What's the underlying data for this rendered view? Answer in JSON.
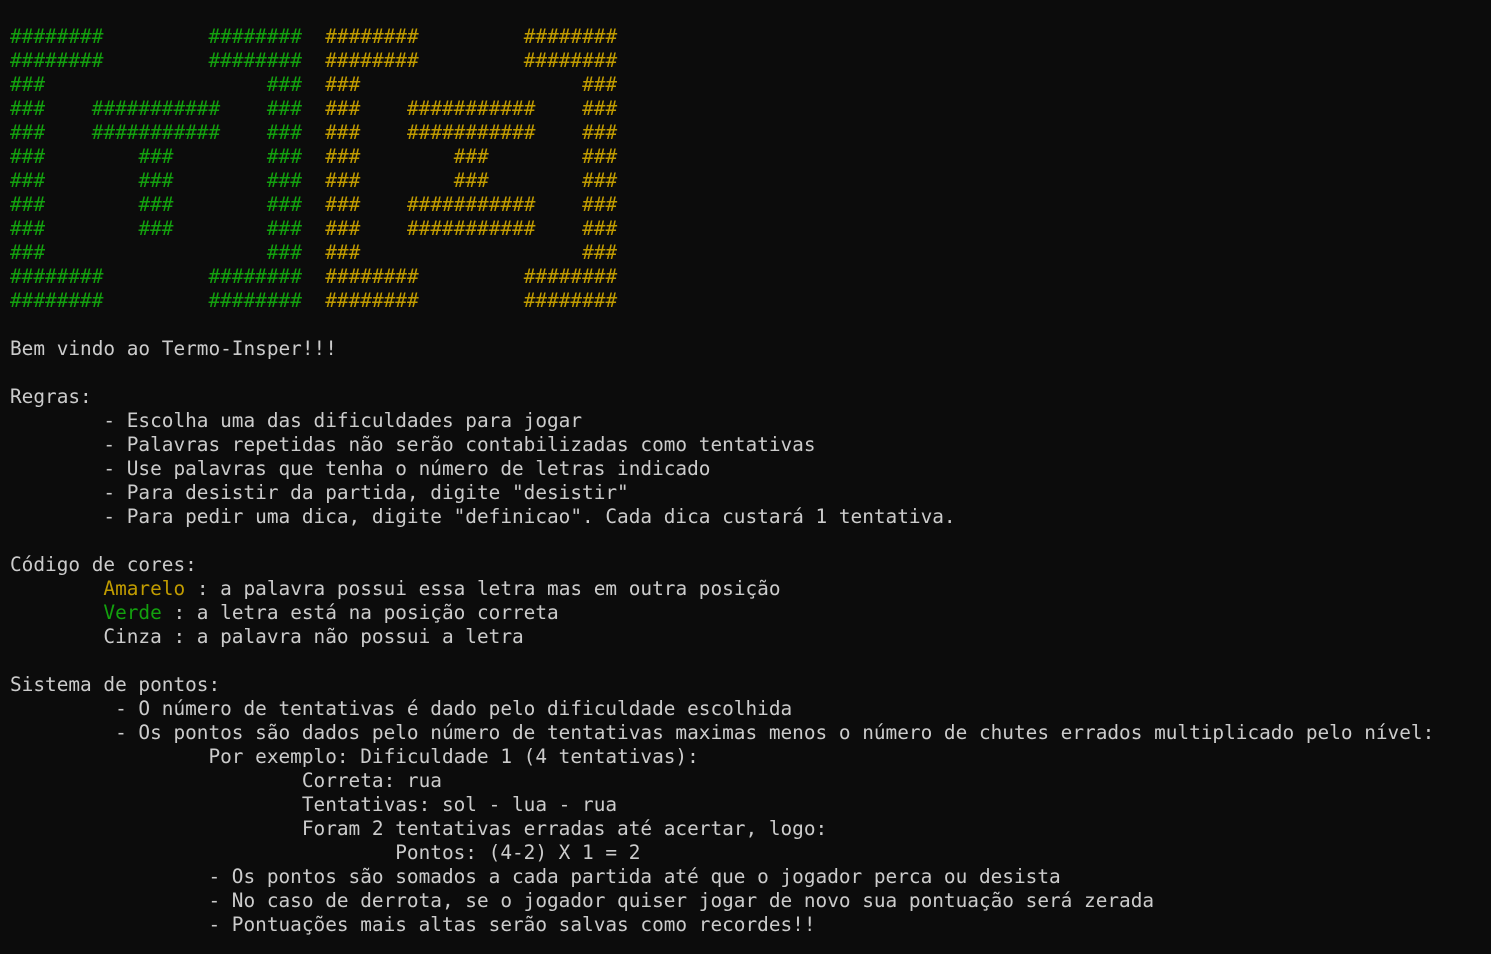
{
  "terminal": {
    "colors": {
      "background": "#0c0c0c",
      "text": "#cccccc",
      "green": "#13a10e",
      "yellow": "#c19c00"
    },
    "lines": [
      [
        {
          "t": "########",
          "c": "green"
        },
        {
          "t": "         ",
          "c": "plain"
        },
        {
          "t": "########",
          "c": "green"
        },
        {
          "t": "  ",
          "c": "plain"
        },
        {
          "t": "########",
          "c": "yellow"
        },
        {
          "t": "         ",
          "c": "plain"
        },
        {
          "t": "########",
          "c": "yellow"
        }
      ],
      [
        {
          "t": "########",
          "c": "green"
        },
        {
          "t": "         ",
          "c": "plain"
        },
        {
          "t": "########",
          "c": "green"
        },
        {
          "t": "  ",
          "c": "plain"
        },
        {
          "t": "########",
          "c": "yellow"
        },
        {
          "t": "         ",
          "c": "plain"
        },
        {
          "t": "########",
          "c": "yellow"
        }
      ],
      [
        {
          "t": "###",
          "c": "green"
        },
        {
          "t": "                   ",
          "c": "plain"
        },
        {
          "t": "###",
          "c": "green"
        },
        {
          "t": "  ",
          "c": "plain"
        },
        {
          "t": "###",
          "c": "yellow"
        },
        {
          "t": "                   ",
          "c": "plain"
        },
        {
          "t": "###",
          "c": "yellow"
        }
      ],
      [
        {
          "t": "###",
          "c": "green"
        },
        {
          "t": "    ",
          "c": "plain"
        },
        {
          "t": "###########",
          "c": "green"
        },
        {
          "t": "    ",
          "c": "plain"
        },
        {
          "t": "###",
          "c": "green"
        },
        {
          "t": "  ",
          "c": "plain"
        },
        {
          "t": "###",
          "c": "yellow"
        },
        {
          "t": "    ",
          "c": "plain"
        },
        {
          "t": "###########",
          "c": "yellow"
        },
        {
          "t": "    ",
          "c": "plain"
        },
        {
          "t": "###",
          "c": "yellow"
        }
      ],
      [
        {
          "t": "###",
          "c": "green"
        },
        {
          "t": "    ",
          "c": "plain"
        },
        {
          "t": "###########",
          "c": "green"
        },
        {
          "t": "    ",
          "c": "plain"
        },
        {
          "t": "###",
          "c": "green"
        },
        {
          "t": "  ",
          "c": "plain"
        },
        {
          "t": "###",
          "c": "yellow"
        },
        {
          "t": "    ",
          "c": "plain"
        },
        {
          "t": "###########",
          "c": "yellow"
        },
        {
          "t": "    ",
          "c": "plain"
        },
        {
          "t": "###",
          "c": "yellow"
        }
      ],
      [
        {
          "t": "###",
          "c": "green"
        },
        {
          "t": "        ",
          "c": "plain"
        },
        {
          "t": "###",
          "c": "green"
        },
        {
          "t": "        ",
          "c": "plain"
        },
        {
          "t": "###",
          "c": "green"
        },
        {
          "t": "  ",
          "c": "plain"
        },
        {
          "t": "###",
          "c": "yellow"
        },
        {
          "t": "        ",
          "c": "plain"
        },
        {
          "t": "###",
          "c": "yellow"
        },
        {
          "t": "        ",
          "c": "plain"
        },
        {
          "t": "###",
          "c": "yellow"
        }
      ],
      [
        {
          "t": "###",
          "c": "green"
        },
        {
          "t": "        ",
          "c": "plain"
        },
        {
          "t": "###",
          "c": "green"
        },
        {
          "t": "        ",
          "c": "plain"
        },
        {
          "t": "###",
          "c": "green"
        },
        {
          "t": "  ",
          "c": "plain"
        },
        {
          "t": "###",
          "c": "yellow"
        },
        {
          "t": "        ",
          "c": "plain"
        },
        {
          "t": "###",
          "c": "yellow"
        },
        {
          "t": "        ",
          "c": "plain"
        },
        {
          "t": "###",
          "c": "yellow"
        }
      ],
      [
        {
          "t": "###",
          "c": "green"
        },
        {
          "t": "        ",
          "c": "plain"
        },
        {
          "t": "###",
          "c": "green"
        },
        {
          "t": "        ",
          "c": "plain"
        },
        {
          "t": "###",
          "c": "green"
        },
        {
          "t": "  ",
          "c": "plain"
        },
        {
          "t": "###",
          "c": "yellow"
        },
        {
          "t": "    ",
          "c": "plain"
        },
        {
          "t": "###########",
          "c": "yellow"
        },
        {
          "t": "    ",
          "c": "plain"
        },
        {
          "t": "###",
          "c": "yellow"
        }
      ],
      [
        {
          "t": "###",
          "c": "green"
        },
        {
          "t": "        ",
          "c": "plain"
        },
        {
          "t": "###",
          "c": "green"
        },
        {
          "t": "        ",
          "c": "plain"
        },
        {
          "t": "###",
          "c": "green"
        },
        {
          "t": "  ",
          "c": "plain"
        },
        {
          "t": "###",
          "c": "yellow"
        },
        {
          "t": "    ",
          "c": "plain"
        },
        {
          "t": "###########",
          "c": "yellow"
        },
        {
          "t": "    ",
          "c": "plain"
        },
        {
          "t": "###",
          "c": "yellow"
        }
      ],
      [
        {
          "t": "###",
          "c": "green"
        },
        {
          "t": "                   ",
          "c": "plain"
        },
        {
          "t": "###",
          "c": "green"
        },
        {
          "t": "  ",
          "c": "plain"
        },
        {
          "t": "###",
          "c": "yellow"
        },
        {
          "t": "                   ",
          "c": "plain"
        },
        {
          "t": "###",
          "c": "yellow"
        }
      ],
      [
        {
          "t": "########",
          "c": "green"
        },
        {
          "t": "         ",
          "c": "plain"
        },
        {
          "t": "########",
          "c": "green"
        },
        {
          "t": "  ",
          "c": "plain"
        },
        {
          "t": "########",
          "c": "yellow"
        },
        {
          "t": "         ",
          "c": "plain"
        },
        {
          "t": "########",
          "c": "yellow"
        }
      ],
      [
        {
          "t": "########",
          "c": "green"
        },
        {
          "t": "         ",
          "c": "plain"
        },
        {
          "t": "########",
          "c": "green"
        },
        {
          "t": "  ",
          "c": "plain"
        },
        {
          "t": "########",
          "c": "yellow"
        },
        {
          "t": "         ",
          "c": "plain"
        },
        {
          "t": "########",
          "c": "yellow"
        }
      ],
      [],
      [
        {
          "t": "Bem vindo ao Termo-Insper!!!",
          "c": "plain"
        }
      ],
      [],
      [
        {
          "t": "Regras:",
          "c": "plain"
        }
      ],
      [
        {
          "t": "        - Escolha uma das dificuldades para jogar",
          "c": "plain"
        }
      ],
      [
        {
          "t": "        - Palavras repetidas não serão contabilizadas como tentativas",
          "c": "plain"
        }
      ],
      [
        {
          "t": "        - Use palavras que tenha o número de letras indicado",
          "c": "plain"
        }
      ],
      [
        {
          "t": "        - Para desistir da partida, digite \"desistir\"",
          "c": "plain"
        }
      ],
      [
        {
          "t": "        - Para pedir uma dica, digite \"definicao\". Cada dica custará 1 tentativa.",
          "c": "plain"
        }
      ],
      [],
      [
        {
          "t": "Código de cores:",
          "c": "plain"
        }
      ],
      [
        {
          "t": "        ",
          "c": "plain"
        },
        {
          "t": "Amarelo",
          "c": "yellow"
        },
        {
          "t": " : a palavra possui essa letra mas em outra posição",
          "c": "plain"
        }
      ],
      [
        {
          "t": "        ",
          "c": "plain"
        },
        {
          "t": "Verde",
          "c": "green"
        },
        {
          "t": " : a letra está na posição correta",
          "c": "plain"
        }
      ],
      [
        {
          "t": "        Cinza : a palavra não possui a letra",
          "c": "plain"
        }
      ],
      [],
      [
        {
          "t": "Sistema de pontos:",
          "c": "plain"
        }
      ],
      [
        {
          "t": "         - O número de tentativas é dado pelo dificuldade escolhida",
          "c": "plain"
        }
      ],
      [
        {
          "t": "         - Os pontos são dados pelo número de tentativas maximas menos o número de chutes errados multiplicado pelo nível:",
          "c": "plain"
        }
      ],
      [
        {
          "t": "                 Por exemplo: Dificuldade 1 (4 tentativas):",
          "c": "plain"
        }
      ],
      [
        {
          "t": "                         Correta: rua",
          "c": "plain"
        }
      ],
      [
        {
          "t": "                         Tentativas: sol - lua - rua",
          "c": "plain"
        }
      ],
      [
        {
          "t": "                         Foram 2 tentativas erradas até acertar, logo:",
          "c": "plain"
        }
      ],
      [
        {
          "t": "                                 Pontos: (4-2) X 1 = 2",
          "c": "plain"
        }
      ],
      [
        {
          "t": "                 - Os pontos são somados a cada partida até que o jogador perca ou desista",
          "c": "plain"
        }
      ],
      [
        {
          "t": "                 - No caso de derrota, se o jogador quiser jogar de novo sua pontuação será zerada",
          "c": "plain"
        }
      ],
      [
        {
          "t": "                 - Pontuações mais altas serão salvas como recordes!!",
          "c": "plain"
        }
      ]
    ]
  }
}
